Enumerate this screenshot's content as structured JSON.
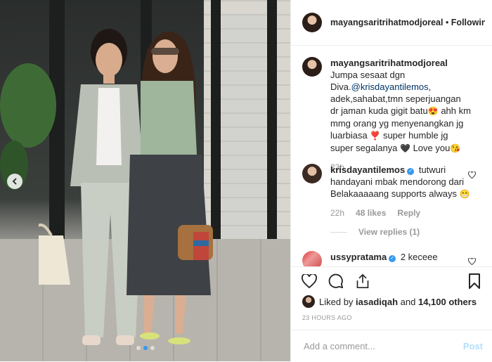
{
  "post": {
    "photo_alt": "",
    "carousel": {
      "count": 3,
      "active": 1
    }
  },
  "header": {
    "username": "mayangsaritrihatmodjoreal",
    "separator": " • ",
    "follow_label": "Following"
  },
  "caption": {
    "username": "mayangsaritrihatmodjoreal",
    "text_before_mention": "Jumpa sesaat dgn Diva.",
    "mention": "@krisdayantilemos",
    "text_after_mention": ", adek,sahabat,tmn seperjuangan dr jaman kuda gigit batu",
    "emoji_1": "😍",
    "text_2": " ahh km mmg orang yg menyenangkan jg luarbiasa ",
    "emoji_2": "❣️",
    "text_3": " super humble jg super segalanya ",
    "emoji_3": "🖤",
    "text_4": " Love you",
    "emoji_4": "😘",
    "time": "23h"
  },
  "comments": [
    {
      "username": "krisdayantilemos",
      "verified": true,
      "text": "tutwuri handayani mbak mendorong dari Belakaaaaang supports always",
      "emoji": "😁",
      "time": "22h",
      "likes": "48 likes",
      "reply_label": "Reply",
      "view_replies": "View replies (1)"
    },
    {
      "username": "ussypratama",
      "verified": true,
      "text": "2 keceee"
    }
  ],
  "actions": {
    "like_icon": "heart-outline-icon",
    "comment_icon": "speech-bubble-icon",
    "share_icon": "share-icon",
    "save_icon": "bookmark-icon"
  },
  "likes": {
    "liked_by_prefix": "Liked by ",
    "liked_by_user": "iasadiqah",
    "and_text": " and ",
    "others": "14,100 others"
  },
  "timestamp": "23 HOURS AGO",
  "add_comment": {
    "placeholder": "Add a comment...",
    "post_label": "Post"
  },
  "colors": {
    "accent": "#3897f0",
    "link": "#003569",
    "muted": "#999999",
    "post_disabled": "#b2dffc"
  }
}
